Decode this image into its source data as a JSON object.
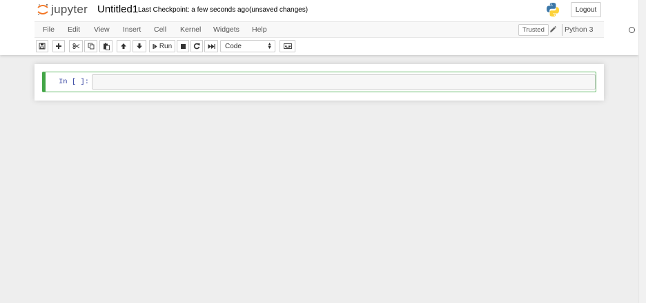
{
  "header": {
    "logo_text": "jupyter",
    "notebook_name": "Untitled1",
    "checkpoint": "Last Checkpoint: a few seconds ago",
    "autosave_status": "(unsaved changes)",
    "logout_label": "Logout"
  },
  "menu": {
    "items": [
      "File",
      "Edit",
      "View",
      "Insert",
      "Cell",
      "Kernel",
      "Widgets",
      "Help"
    ],
    "trusted_label": "Trusted",
    "kernel_name": "Python 3"
  },
  "toolbar": {
    "run_label": "Run",
    "cell_type": "Code"
  },
  "cell": {
    "prompt": "In [ ]:",
    "code": ""
  },
  "colors": {
    "logo_orange": "#f37726",
    "cell_border_green": "#42a546",
    "prompt_blue": "#303f9f"
  }
}
